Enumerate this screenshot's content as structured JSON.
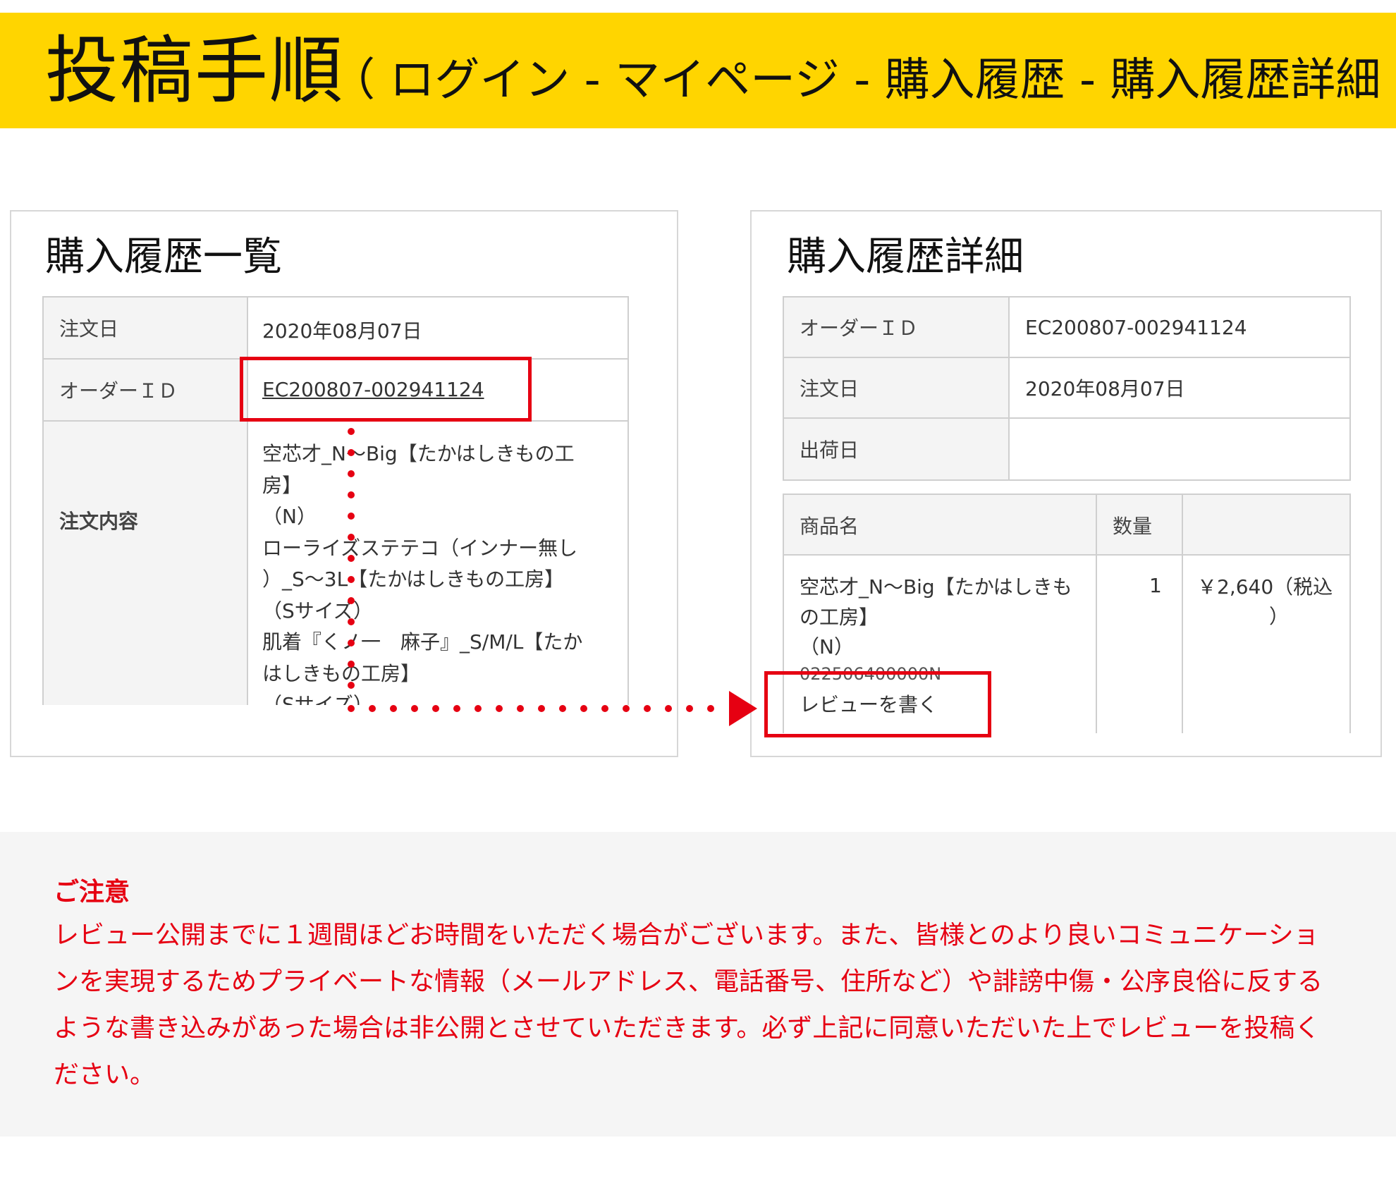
{
  "header": {
    "title": "投稿手順",
    "subtitle": "（ ログイン - マイページ - 購入履歴 - 購入履歴詳細 ）"
  },
  "list_panel": {
    "heading": "購入履歴一覧",
    "rows": {
      "order_date_label": "注文日",
      "order_date_value": "2020年08月07日",
      "order_id_label": "オーダーＩＤ",
      "order_id_value": "EC200807-002941124",
      "contents_label": "注文内容"
    },
    "items": [
      "空芯才_N～Big【たかはしきもの工",
      "房】",
      "（N）",
      "ローライズステテコ（インナー無し",
      "）_S～3L【たかはしきもの工房】",
      "（Sサイズ）",
      "肌着『くノ一　麻子』_S/M/L【たか",
      "はしきもの工房】",
      "（Sサイズ）"
    ]
  },
  "detail_panel": {
    "heading": "購入履歴詳細",
    "info": {
      "order_id_label": "オーダーＩＤ",
      "order_id_value": "EC200807-002941124",
      "order_date_label": "注文日",
      "order_date_value": "2020年08月07日",
      "ship_date_label": "出荷日",
      "ship_date_value": ""
    },
    "products": {
      "col_name": "商品名",
      "col_qty": "数量",
      "name_lines": [
        "空芯才_N～Big【たかはしきも",
        "の工房】",
        "（N）"
      ],
      "code": "022506400000N",
      "review_link": "レビューを書く",
      "qty": "1",
      "price_lines": [
        "￥2,640（税込",
        "）"
      ]
    }
  },
  "notice": {
    "title": "ご注意",
    "body": "レビュー公開までに１週間ほどお時間をいただく場合がございます。また、皆様とのより良いコミュニケーションを実現するためプライベートな情報（メールアドレス、電話番号、住所など）や誹謗中傷・公序良俗に反するような書き込みがあった場合は非公開とさせていただきます。必ず上記に同意いただいた上でレビューを投稿ください。"
  },
  "colors": {
    "banner": "#ffd500",
    "highlight": "#e60012",
    "label_bg": "#f4f4f4",
    "notice_bg": "#f5f5f5"
  }
}
